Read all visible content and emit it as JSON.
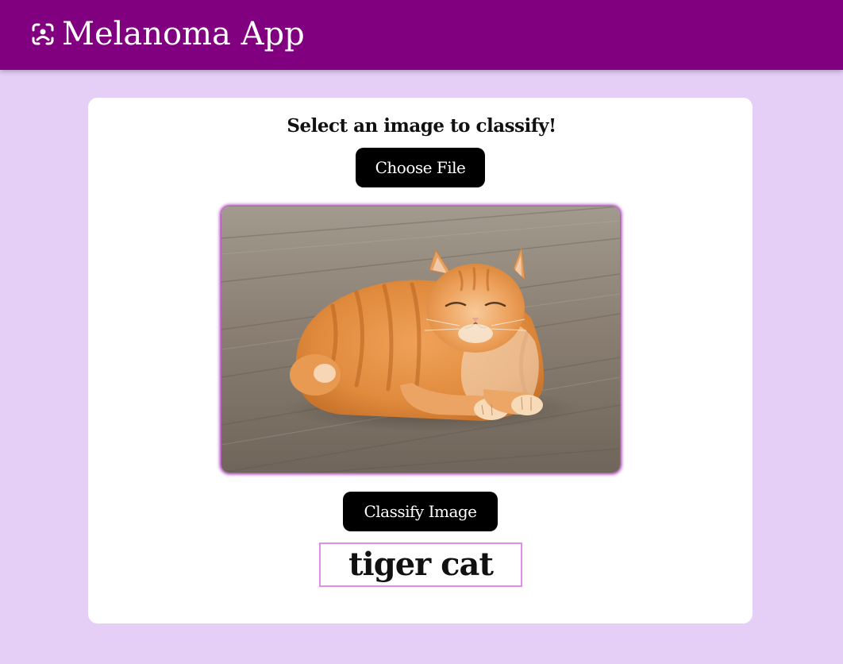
{
  "header": {
    "title": "Melanoma App",
    "logo_icon": "face-scan-icon",
    "background_color": "#800080"
  },
  "main": {
    "prompt": "Select an image to classify!",
    "choose_file_label": "Choose File",
    "preview_image": "orange tabby cat lying on wooden floor",
    "classify_label": "Classify Image",
    "result": "tiger cat"
  },
  "colors": {
    "page_background": "#e5cff6",
    "button": "#000000",
    "result_border": "#e28de8",
    "image_glow": "#9b2aa8"
  }
}
